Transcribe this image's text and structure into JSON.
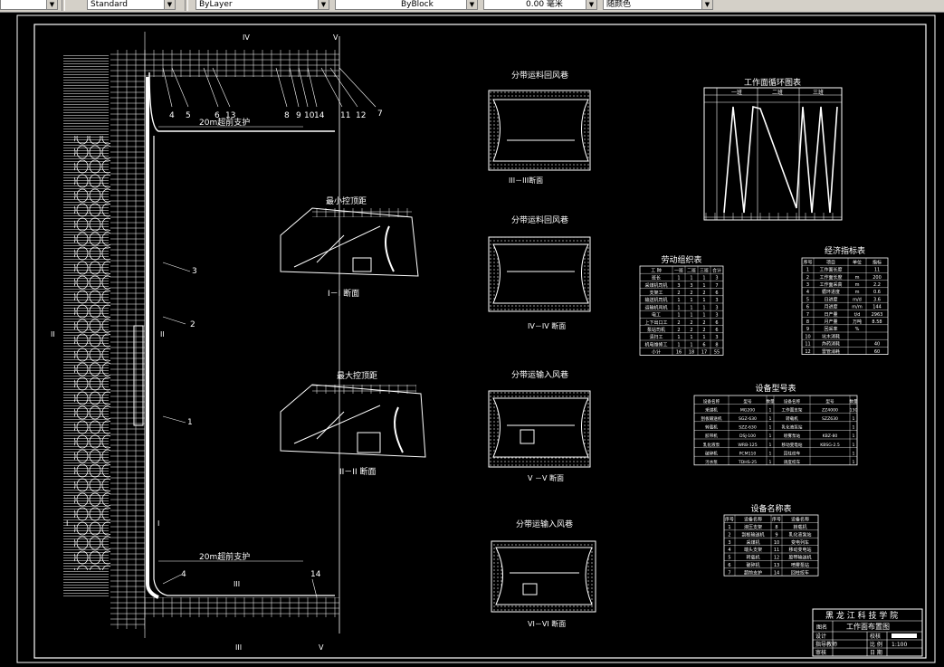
{
  "toolbar": {
    "textstyle": "Standard",
    "layer": "ByLayer",
    "linetype": "ByBlock",
    "lineweight": "0.00 毫米",
    "color": "随颜色"
  },
  "plan": {
    "support_top": "20m超前支护",
    "support_bottom": "20m超前支护",
    "labels": [
      "1",
      "2",
      "3",
      "4",
      "5",
      "6",
      "7",
      "8",
      "9",
      "10",
      "11",
      "12",
      "13",
      "14"
    ],
    "sec_II": "II",
    "sec_I": "I",
    "sec_III": "III",
    "sec_IV": "IV",
    "sec_V": "V",
    "sec_VI": "VI"
  },
  "sections": {
    "min": "最小控顶距",
    "min_cap": "I－I 断面",
    "max": "最大控顶距",
    "max_cap": "II－II 断面",
    "s3_title": "分带运料回风巷",
    "s3_cap": "III－III断面",
    "s4_title": "分带运料回风巷",
    "s4_cap": "IV－IV 断面",
    "s5_title": "分带运输入风巷",
    "s5_cap": "V －V 断面",
    "s6_title": "分带运输入风巷",
    "s6_cap": "VI－VI 断面"
  },
  "cycle": {
    "title": "工作面循环图表",
    "cols": [
      "一班",
      "二班",
      "三班"
    ]
  },
  "labor": {
    "title": "劳动组织表",
    "headers": [
      "工 种",
      "一班",
      "二班",
      "三班",
      "合计"
    ],
    "rows": [
      [
        "班长",
        "1",
        "1",
        "1",
        "3"
      ],
      [
        "采煤机司机",
        "3",
        "3",
        "1",
        "7"
      ],
      [
        "支架工",
        "2",
        "2",
        "2",
        "6"
      ],
      [
        "输送机司机",
        "1",
        "1",
        "1",
        "3"
      ],
      [
        "运输机司机",
        "1",
        "1",
        "1",
        "3"
      ],
      [
        "电工",
        "1",
        "1",
        "1",
        "3"
      ],
      [
        "上下出口工",
        "2",
        "2",
        "2",
        "6"
      ],
      [
        "泵站司机",
        "2",
        "2",
        "2",
        "6"
      ],
      [
        "清扫工",
        "1",
        "1",
        "1",
        "3"
      ],
      [
        "机电维修工",
        "1",
        "1",
        "6",
        "8"
      ],
      [
        "小计",
        "16",
        "18",
        "17",
        "55"
      ]
    ]
  },
  "economic": {
    "title": "经济指标表",
    "headers": [
      "序号",
      "项目",
      "单位",
      "指标"
    ],
    "rows": [
      [
        "1",
        "工作面长度",
        "",
        "11"
      ],
      [
        "2",
        "工作面长度",
        "m",
        "200"
      ],
      [
        "3",
        "工作面采高",
        "m",
        "2.2"
      ],
      [
        "4",
        "循环进度",
        "m",
        "0.6"
      ],
      [
        "5",
        "日进度",
        "m/d",
        "3.6"
      ],
      [
        "6",
        "月进度",
        "m/m",
        "144"
      ],
      [
        "7",
        "日产量",
        "t/d",
        "2963"
      ],
      [
        "8",
        "月产量",
        "万吨",
        "8.58"
      ],
      [
        "9",
        "回采率",
        "%",
        ""
      ],
      [
        "10",
        "坑木消耗",
        "",
        ""
      ],
      [
        "11",
        "炸药消耗",
        "",
        "40"
      ],
      [
        "12",
        "雷管消耗",
        "",
        "60"
      ]
    ]
  },
  "equipment": {
    "title": "设备型号表",
    "headers": [
      "设备名称",
      "型号",
      "数量",
      "设备名称",
      "型号",
      "数量"
    ],
    "rows": [
      [
        "采煤机",
        "MG200",
        "1",
        "工作面支架",
        "ZZ4000",
        "130"
      ],
      [
        "刮板输送机",
        "SGZ-630",
        "1",
        "转载机",
        "SZZ630",
        "1"
      ],
      [
        "转载机",
        "SZZ-630",
        "1",
        "乳化液泵站",
        "",
        "1"
      ],
      [
        "胶带机",
        "DSJ-100",
        "1",
        "喷雾泵站",
        "KBZ-80",
        "1"
      ],
      [
        "乳化液泵",
        "WRB-125",
        "1",
        "移动变电站",
        "KBSG-2.5",
        "1"
      ],
      [
        "破碎机",
        "PCM110",
        "1",
        "回柱绞车",
        "",
        "1"
      ],
      [
        "污水泵",
        "TDHS-25",
        "1",
        "调度绞车",
        "",
        "1"
      ]
    ]
  },
  "names": {
    "title": "设备名称表",
    "headers": [
      "序号",
      "设备名称",
      "序号",
      "设备名称"
    ],
    "rows": [
      [
        "1",
        "液压支架",
        "8",
        "转载机"
      ],
      [
        "2",
        "刮板输送机",
        "9",
        "乳化液泵站"
      ],
      [
        "3",
        "采煤机",
        "10",
        "变电列车"
      ],
      [
        "4",
        "端头支架",
        "11",
        "移动变电站"
      ],
      [
        "5",
        "转载机",
        "12",
        "胶带输送机"
      ],
      [
        "6",
        "破碎机",
        "13",
        "喷雾泵站"
      ],
      [
        "7",
        "超前支护",
        "14",
        "回柱绞车"
      ]
    ]
  },
  "titleblock": {
    "school": "黑 龙 江 科 技 学 院",
    "label_name": "图名",
    "drawing": "工作面布置图",
    "design": "设计",
    "check": "校核",
    "guide": "指导教师",
    "review": "审核",
    "scale_label": "比 例",
    "scale": "1:100",
    "date_label": "日 期"
  },
  "colors": {
    "bg": "#000000",
    "line": "#ffffff",
    "toolbar": "#d4d0c8"
  }
}
